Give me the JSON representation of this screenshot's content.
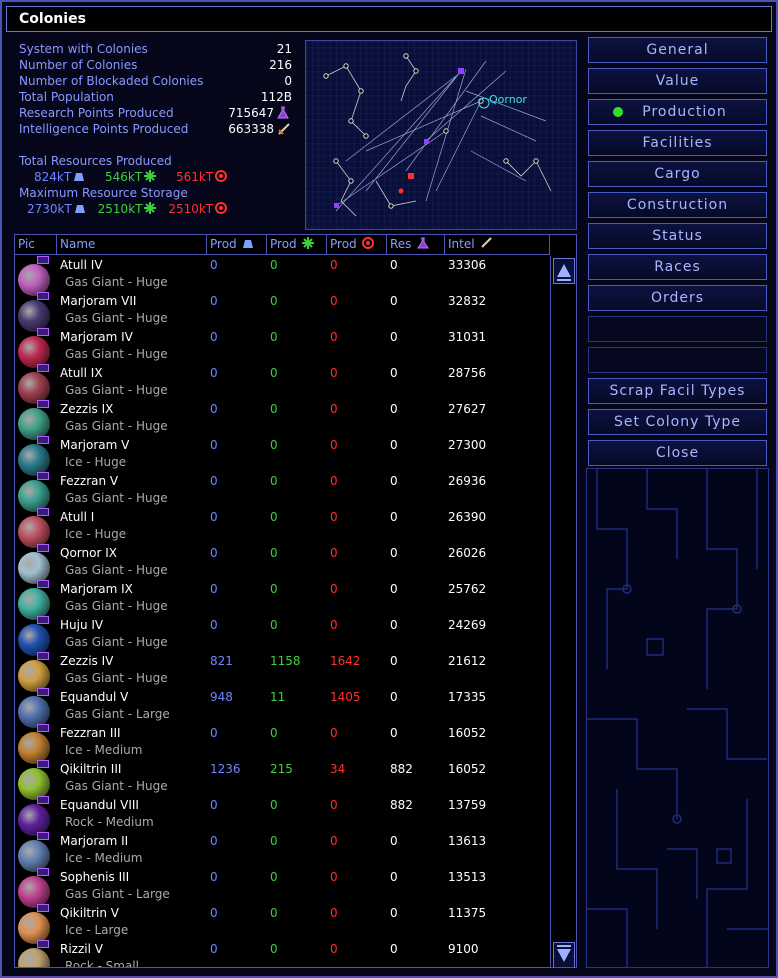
{
  "window": {
    "title": "Colonies"
  },
  "stats": [
    {
      "label": "System with Colonies",
      "value": "21"
    },
    {
      "label": "Number of Colonies",
      "value": "216"
    },
    {
      "label": "Number of Blockaded Colonies",
      "value": "0"
    },
    {
      "label": "Total Population",
      "value": "112B"
    },
    {
      "label": "Research Points Produced",
      "value": "715647"
    },
    {
      "label": "Intelligence Points Produced",
      "value": "663338"
    }
  ],
  "resources": {
    "produced_label": "Total Resources Produced",
    "produced": [
      "824kT",
      "546kT",
      "561kT"
    ],
    "storage_label": "Maximum Resource Storage",
    "storage": [
      "2730kT",
      "2510kT",
      "2510kT"
    ]
  },
  "map": {
    "label": "Qornor"
  },
  "buttons": [
    {
      "label": "General",
      "active": false
    },
    {
      "label": "Value",
      "active": false
    },
    {
      "label": "Production",
      "active": true
    },
    {
      "label": "Facilities",
      "active": false
    },
    {
      "label": "Cargo",
      "active": false
    },
    {
      "label": "Construction",
      "active": false
    },
    {
      "label": "Status",
      "active": false
    },
    {
      "label": "Races",
      "active": false
    },
    {
      "label": "Orders",
      "active": false
    },
    {
      "label": "",
      "active": false
    },
    {
      "label": "",
      "active": false
    },
    {
      "label": "Scrap Facil Types",
      "active": false
    },
    {
      "label": "Set Colony Type",
      "active": false
    },
    {
      "label": "Close",
      "active": false
    }
  ],
  "table": {
    "headers": [
      "Pic",
      "Name",
      "Prod",
      "Prod",
      "Prod",
      "Res",
      "Intel"
    ],
    "rows": [
      {
        "name": "Atull IV",
        "type": "Gas Giant - Huge",
        "p1": "0",
        "p2": "0",
        "p3": "0",
        "res": "0",
        "intel": "33306",
        "color": "#c060c0"
      },
      {
        "name": "Marjoram VII",
        "type": "Gas Giant - Huge",
        "p1": "0",
        "p2": "0",
        "p3": "0",
        "res": "0",
        "intel": "32832",
        "color": "#4a3a70"
      },
      {
        "name": "Marjoram IV",
        "type": "Gas Giant - Huge",
        "p1": "0",
        "p2": "0",
        "p3": "0",
        "res": "0",
        "intel": "31031",
        "color": "#c02850"
      },
      {
        "name": "Atull IX",
        "type": "Gas Giant - Huge",
        "p1": "0",
        "p2": "0",
        "p3": "0",
        "res": "0",
        "intel": "28756",
        "color": "#a04050"
      },
      {
        "name": "Zezzis IX",
        "type": "Gas Giant - Huge",
        "p1": "0",
        "p2": "0",
        "p3": "0",
        "res": "0",
        "intel": "27627",
        "color": "#40a088"
      },
      {
        "name": "Marjoram V",
        "type": "Ice - Huge",
        "p1": "0",
        "p2": "0",
        "p3": "0",
        "res": "0",
        "intel": "27300",
        "color": "#2a7a8a"
      },
      {
        "name": "Fezzran V",
        "type": "Gas Giant - Huge",
        "p1": "0",
        "p2": "0",
        "p3": "0",
        "res": "0",
        "intel": "26936",
        "color": "#3aa090"
      },
      {
        "name": "Atull I",
        "type": "Ice - Huge",
        "p1": "0",
        "p2": "0",
        "p3": "0",
        "res": "0",
        "intel": "26390",
        "color": "#c05060"
      },
      {
        "name": "Qornor IX",
        "type": "Gas Giant - Huge",
        "p1": "0",
        "p2": "0",
        "p3": "0",
        "res": "0",
        "intel": "26026",
        "color": "#a0c0d0"
      },
      {
        "name": "Marjoram IX",
        "type": "Gas Giant - Huge",
        "p1": "0",
        "p2": "0",
        "p3": "0",
        "res": "0",
        "intel": "25762",
        "color": "#40b0a0"
      },
      {
        "name": "Huju IV",
        "type": "Gas Giant - Huge",
        "p1": "0",
        "p2": "0",
        "p3": "0",
        "res": "0",
        "intel": "24269",
        "color": "#2050b0"
      },
      {
        "name": "Zezzis IV",
        "type": "Gas Giant - Huge",
        "p1": "821",
        "p2": "1158",
        "p3": "1642",
        "res": "0",
        "intel": "21612",
        "color": "#d0a040"
      },
      {
        "name": "Equandul V",
        "type": "Gas Giant - Large",
        "p1": "948",
        "p2": "11",
        "p3": "1405",
        "res": "0",
        "intel": "17335",
        "color": "#5070b0"
      },
      {
        "name": "Fezzran III",
        "type": "Ice - Medium",
        "p1": "0",
        "p2": "0",
        "p3": "0",
        "res": "0",
        "intel": "16052",
        "color": "#c08030"
      },
      {
        "name": "Qikiltrin III",
        "type": "Gas Giant - Huge",
        "p1": "1236",
        "p2": "215",
        "p3": "34",
        "res": "882",
        "intel": "16052",
        "color": "#90c030"
      },
      {
        "name": "Equandul VIII",
        "type": "Rock - Medium",
        "p1": "0",
        "p2": "0",
        "p3": "0",
        "res": "882",
        "intel": "13759",
        "color": "#6020a0"
      },
      {
        "name": "Marjoram II",
        "type": "Ice - Medium",
        "p1": "0",
        "p2": "0",
        "p3": "0",
        "res": "0",
        "intel": "13613",
        "color": "#6080b0"
      },
      {
        "name": "Sophenis III",
        "type": "Gas Giant - Large",
        "p1": "0",
        "p2": "0",
        "p3": "0",
        "res": "0",
        "intel": "13513",
        "color": "#c04090"
      },
      {
        "name": "Qikiltrin V",
        "type": "Ice - Large",
        "p1": "0",
        "p2": "0",
        "p3": "0",
        "res": "0",
        "intel": "11375",
        "color": "#e09050"
      },
      {
        "name": "Rizzil V",
        "type": "Rock - Small",
        "p1": "0",
        "p2": "0",
        "p3": "0",
        "res": "0",
        "intel": "9100",
        "color": "#c0a070"
      }
    ]
  }
}
